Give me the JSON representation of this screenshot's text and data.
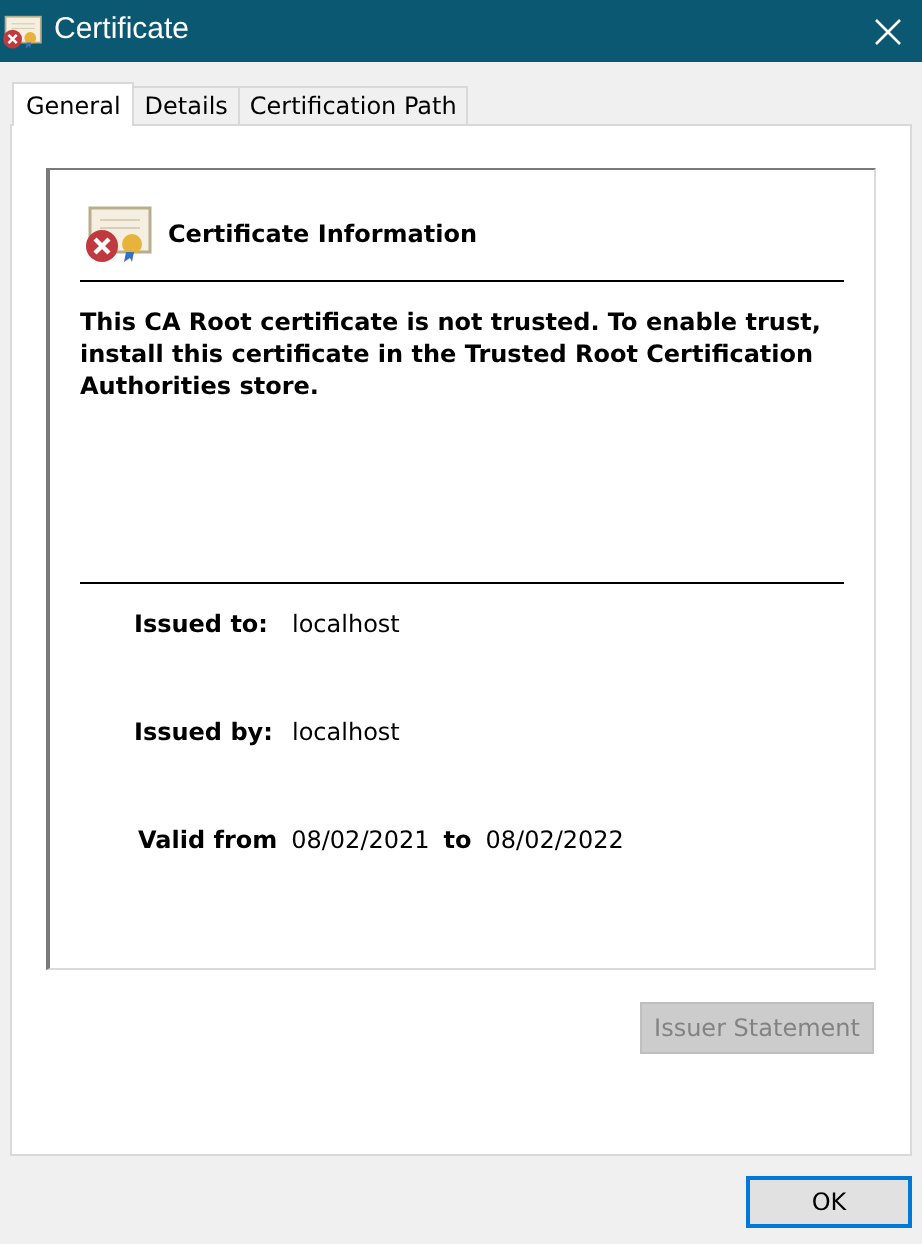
{
  "window": {
    "title": "Certificate"
  },
  "tabs": [
    {
      "label": "General",
      "selected": true
    },
    {
      "label": "Details",
      "selected": false
    },
    {
      "label": "Certification Path",
      "selected": false
    }
  ],
  "info": {
    "heading": "Certificate Information",
    "message": "This CA Root certificate is not trusted. To enable trust, install this certificate in the Trusted Root Certification Authorities store.",
    "issued_to_label": "Issued to:",
    "issued_to": "localhost",
    "issued_by_label": "Issued by:",
    "issued_by": "localhost",
    "valid_from_label": "Valid from",
    "valid_from": "08/02/2021",
    "valid_to_label": "to",
    "valid_to": "08/02/2022"
  },
  "issuer_statement": {
    "label": "Issuer Statement",
    "disabled": true
  },
  "ok": {
    "label": "OK",
    "focused": true
  }
}
